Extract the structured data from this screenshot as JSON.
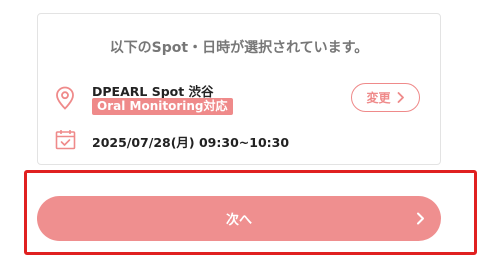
{
  "card": {
    "header": "以下のSpot・日時が選択されています。",
    "spot": {
      "icon": "location-pin-icon",
      "name": "DPEARL Spot 渋谷",
      "tag": "Oral Monitoring対応"
    },
    "change_label": "変更",
    "date": {
      "icon": "calendar-check-icon",
      "text": "2025/07/28(月) 09:30~10:30"
    }
  },
  "next_button": {
    "label": "次へ",
    "icon": "chevron-right-icon"
  },
  "colors": {
    "accent": "#ef8a8a",
    "button": "#ef8f8f",
    "highlight": "#e02020"
  }
}
